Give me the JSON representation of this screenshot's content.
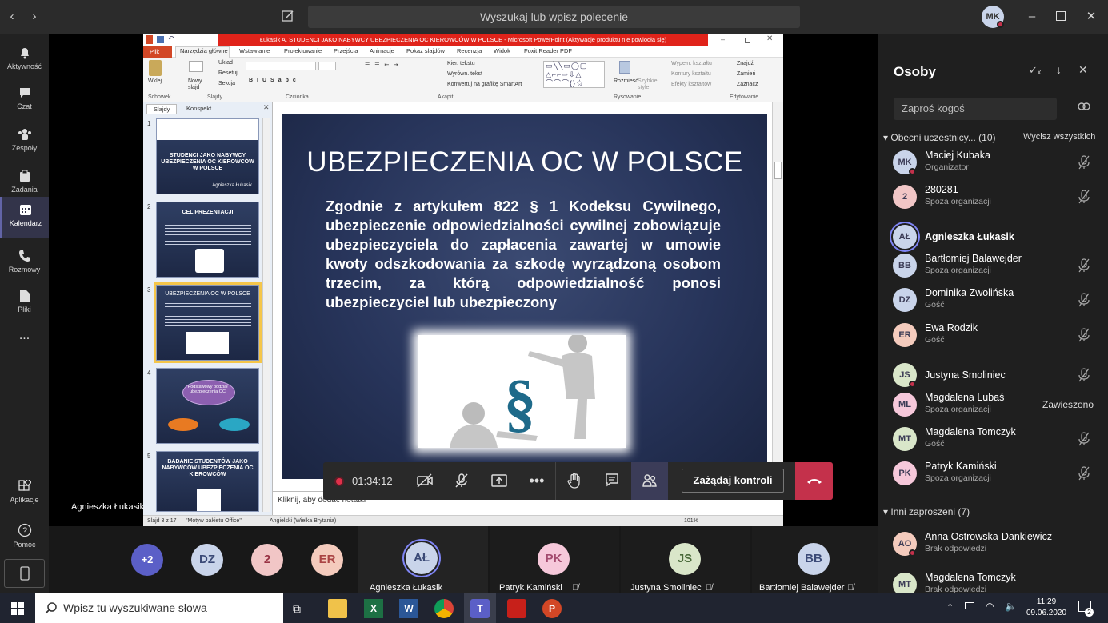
{
  "topbar": {
    "search_placeholder": "Wyszukaj lub wpisz polecenie",
    "user_initials": "MK"
  },
  "rail": [
    {
      "label": "Aktywność",
      "icon": "bell-icon"
    },
    {
      "label": "Czat",
      "icon": "chat-icon"
    },
    {
      "label": "Zespoły",
      "icon": "teams-icon"
    },
    {
      "label": "Zadania",
      "icon": "tasks-icon"
    },
    {
      "label": "Kalendarz",
      "icon": "calendar-icon",
      "active": true
    },
    {
      "label": "Rozmowy",
      "icon": "phone-icon"
    },
    {
      "label": "Pliki",
      "icon": "files-icon"
    },
    {
      "label": "...",
      "icon": "more-icon"
    },
    {
      "label": "Aplikacje",
      "icon": "apps-icon"
    },
    {
      "label": "Pomoc",
      "icon": "help-icon"
    }
  ],
  "ppt": {
    "window_title": "Łukasik A. STUDENCI JAKO NABYWCY UBEZPIECZENIA OC KIEROWCÓW W POLSCE - Microsoft PowerPoint (Aktywacje produktu nie powiodła się)",
    "tabs": [
      "Plik",
      "Narzędzia główne",
      "Wstawianie",
      "Projektowanie",
      "Przejścia",
      "Animacje",
      "Pokaz slajdów",
      "Recenzja",
      "Widok",
      "Foxit Reader PDF"
    ],
    "ribbon_groups": [
      "Schowek",
      "Slajdy",
      "Czcionka",
      "Akapit",
      "Rysowanie",
      "Edytowanie"
    ],
    "ribbon_buttons": {
      "paste": "Wklej",
      "new_slide": "Nowy slajd",
      "layout": "Układ",
      "reset": "Resetuj",
      "section": "Sekcja",
      "text_dir": "Kier. tekstu",
      "align_text": "Wyrówn. tekst",
      "smartart": "Konwertuj na grafikę SmartArt",
      "arrange": "Rozmieść",
      "quick_styles": "Szybkie style",
      "fill": "Wypełn. kształtu",
      "outline": "Kontury kształtu",
      "effects": "Efekty kształtów",
      "find": "Znajdź",
      "replace": "Zamień",
      "select": "Zaznacz"
    },
    "panel_tabs": [
      "Slajdy",
      "Konspekt"
    ],
    "thumbs": [
      {
        "num": "1",
        "title": "STUDENCI JAKO NABYWCY UBEZPIECZENIA OC KIEROWCÓW W POLSCE",
        "sub": "Agnieszka Łukasik"
      },
      {
        "num": "2",
        "title": "CEL PREZENTACJI"
      },
      {
        "num": "3",
        "title": "UBEZPIECZENIA OC W POLSCE"
      },
      {
        "num": "4",
        "title": "Podstawowy podział ubezpieczenia OC"
      },
      {
        "num": "5",
        "title": "BADANIE STUDENTÓW JAKO NABYWCÓW UBEZPIECZENIA OC KIEROWCÓW"
      }
    ],
    "slide_title": "UBEZPIECZENIA OC W POLSCE",
    "slide_body": "Zgodnie z artykułem 822 § 1 Kodeksu Cywilnego, ubezpieczenie odpowiedzialności cywilnej zobowiązuje ubezpieczyciela do zapłacenia zawartej w umowie kwoty odszkodowania za szkodę wyrządzoną osobom trzecim, za którą odpowiedzialność ponosi ubezpieczyciel lub ubezpieczony",
    "notes_placeholder": "Kliknij, aby dodać notatki",
    "status": {
      "slide": "Slajd 3 z 17",
      "theme": "\"Motyw pakietu Office\"",
      "lang": "Angielski (Wielka Brytania)",
      "zoom": "101%"
    }
  },
  "call": {
    "timer": "01:34:12",
    "request_control": "Zażądaj kontroli",
    "presenter": "Agnieszka Łukasik"
  },
  "strip": [
    {
      "initials": "+2",
      "bg": "#5b5fc7"
    },
    {
      "initials": "DZ",
      "bg": "#c9d4ea"
    },
    {
      "initials": "2",
      "bg": "#f1c6c6"
    },
    {
      "initials": "ER",
      "bg": "#f4cbbd"
    },
    {
      "initials": "AŁ",
      "bg": "#c9d4ea",
      "name": "Agnieszka Łukasik"
    },
    {
      "initials": "PK",
      "bg": "#f6c8da",
      "name": "Patryk Kamiński"
    },
    {
      "initials": "JS",
      "bg": "#d9e6c9",
      "name": "Justyna Smoliniec"
    },
    {
      "initials": "BB",
      "bg": "#c9d4ea",
      "name": "Bartłomiej Balawejder"
    }
  ],
  "people": {
    "title": "Osoby",
    "invite_placeholder": "Zaproś kogoś",
    "present_label": "Obecni uczestnicy... (10)",
    "mute_all": "Wycisz wszystkich",
    "present": [
      {
        "initials": "MK",
        "name": "Maciej Kubaka",
        "sub": "Organizator",
        "bg": "#c9d4ea"
      },
      {
        "initials": "2",
        "name": "280281",
        "sub": "Spoza organizacji",
        "bg": "#f1c6c6"
      },
      {
        "initials": "AŁ",
        "name": "Agnieszka Łukasik",
        "sub": "",
        "bg": "#c9d4ea"
      },
      {
        "initials": "BB",
        "name": "Bartłomiej Balawejder",
        "sub": "Spoza organizacji",
        "bg": "#c9d4ea"
      },
      {
        "initials": "DZ",
        "name": "Dominika Zwolińska",
        "sub": "Gość",
        "bg": "#c9d4ea"
      },
      {
        "initials": "ER",
        "name": "Ewa Rodzik",
        "sub": "Gość",
        "bg": "#f4cbbd"
      },
      {
        "initials": "JS",
        "name": "Justyna Smoliniec",
        "sub": "",
        "bg": "#d9e6c9"
      },
      {
        "initials": "ML",
        "name": "Magdalena Lubaś",
        "sub": "Spoza organizacji",
        "bg": "#f6c8da",
        "status": "Zawieszono"
      },
      {
        "initials": "MT",
        "name": "Magdalena Tomczyk",
        "sub": "Gość",
        "bg": "#d9e6c9"
      },
      {
        "initials": "PK",
        "name": "Patryk Kamiński",
        "sub": "Spoza organizacji",
        "bg": "#f6c8da"
      }
    ],
    "invited_label": "Inni zaproszeni (7)",
    "invited": [
      {
        "initials": "AO",
        "name": "Anna Ostrowska-Dankiewicz",
        "sub": "Brak odpowiedzi",
        "bg": "#f4cbbd"
      },
      {
        "initials": "MT",
        "name": "Magdalena Tomczyk",
        "sub": "Brak odpowiedzi",
        "bg": "#d9e6c9"
      }
    ]
  },
  "taskbar": {
    "search": "Wpisz tu wyszukiwane słowa",
    "time": "11:29",
    "date": "09.06.2020",
    "notifications": "2"
  }
}
